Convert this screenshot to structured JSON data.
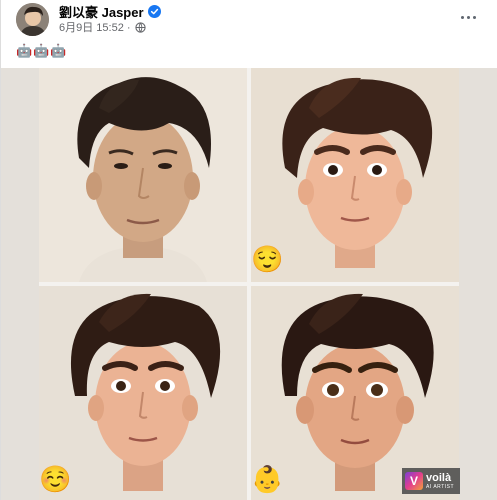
{
  "post": {
    "author_name": "劉以豪 Jasper",
    "timestamp": "6月9日 15:52 ·",
    "audience_icon": "globe-icon",
    "verified_icon": "verified-badge-icon",
    "more_icon": "more-options-icon",
    "post_text": [
      "🤖",
      "🤖",
      "🤖"
    ]
  },
  "media": {
    "panels": [
      {
        "name": "original-photo",
        "style": "photo"
      },
      {
        "name": "cartoon-style-1",
        "style": "cartoon"
      },
      {
        "name": "cartoon-style-2",
        "style": "cartoon"
      },
      {
        "name": "cartoon-style-3",
        "style": "cartoon"
      }
    ],
    "emojis": [
      "😌",
      "☺️",
      "👶"
    ],
    "watermark": {
      "logo_letter": "V",
      "title": "voilà",
      "subtitle": "AI ARTIST"
    }
  },
  "colors": {
    "verified": "#1877f2",
    "name_text": "#050505",
    "meta_text": "#65676b",
    "collage_background": "#e4e0da"
  }
}
